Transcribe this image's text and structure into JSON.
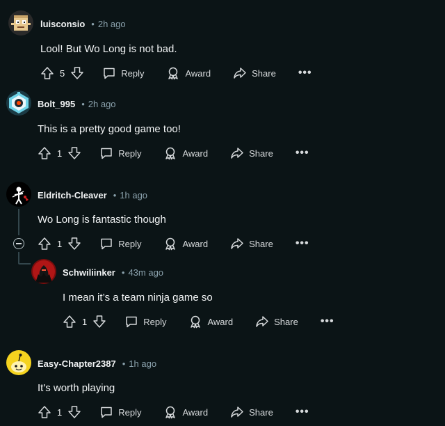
{
  "comments": [
    {
      "username": "luisconsio",
      "time": "2h ago",
      "body": "Lool! But Wo Long is not bad.",
      "votes": "5",
      "avatar_icon": "pixel-box-character-avatar"
    },
    {
      "username": "Bolt_995",
      "time": "2h ago",
      "body": "This is a pretty good game too!",
      "votes": "1",
      "avatar_icon": "robot-avatar"
    },
    {
      "username": "Eldritch-Cleaver",
      "time": "1h ago",
      "body": "Wo Long is fantastic though",
      "votes": "1",
      "avatar_icon": "pirate-flag-avatar"
    },
    {
      "username": "Schwiliinker",
      "time": "43m ago",
      "body": "I mean it’s a team ninja game so",
      "votes": "1",
      "avatar_icon": "dark-knight-avatar"
    },
    {
      "username": "Easy-Chapter2387",
      "time": "1h ago",
      "body": "It's worth playing",
      "votes": "1",
      "avatar_icon": "snoo-yellow-avatar"
    }
  ],
  "actions": {
    "reply": "Reply",
    "award": "Award",
    "share": "Share",
    "more": "•••"
  },
  "colors": {
    "background": "#0b1416",
    "text": "#f2f4f5",
    "meta": "#8ba2ad",
    "thread_line": "#33464c"
  }
}
